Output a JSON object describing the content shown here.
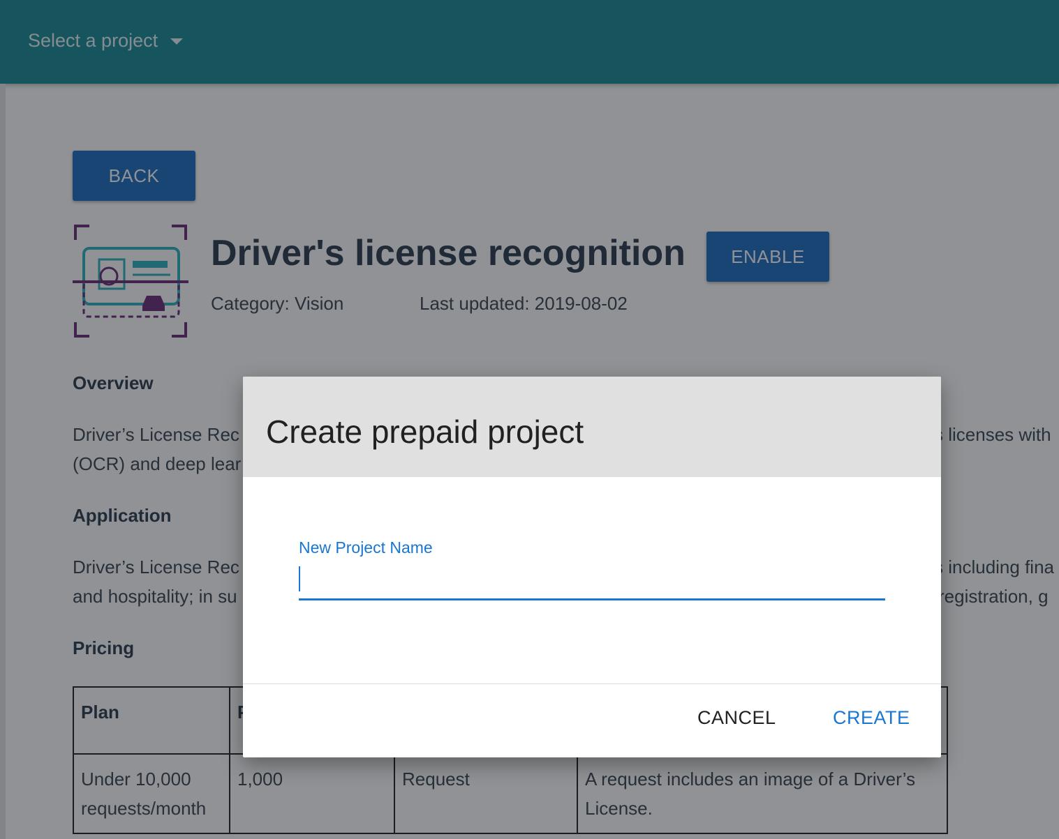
{
  "topbar": {
    "project_select_label": "Select a project"
  },
  "page": {
    "back_label": "BACK",
    "title": "Driver's license recognition",
    "enable_label": "ENABLE",
    "category": "Category: Vision",
    "last_updated": "Last updated: 2019-08-02",
    "overview_heading": "Overview",
    "overview_line1_left": "Driver’s License Rec",
    "overview_line1_right": "s licenses with",
    "overview_line2_left": "(OCR) and deep lear",
    "application_heading": "Application",
    "application_line1_left": "Driver’s License Rec",
    "application_line1_right": "s including fina",
    "application_line2_left": "and hospitality; in su",
    "application_line2_right": "registration, g",
    "pricing_heading": "Pricing",
    "pricing_table": {
      "headers": [
        "Plan",
        "P",
        "",
        ""
      ],
      "rows": [
        [
          "Under 10,000 requests/month",
          "1,000",
          "Request",
          "A request includes an image of a Driver’s License."
        ]
      ]
    },
    "logo_icon": "drivers-license-scan-icon"
  },
  "dialog": {
    "title": "Create prepaid project",
    "field_label": "New Project Name",
    "field_value": "",
    "cancel_label": "CANCEL",
    "create_label": "CREATE"
  },
  "colors": {
    "topbar": "#1a8a98",
    "primary_button": "#1e6fc0",
    "accent": "#1976d2",
    "dialog_header": "#e0e0e0"
  }
}
